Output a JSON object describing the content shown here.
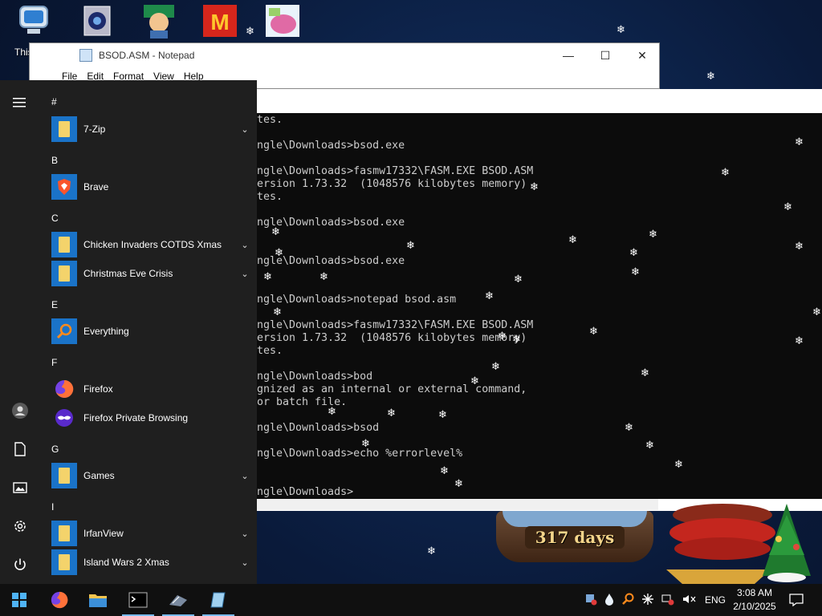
{
  "desktop": {
    "icons": [
      {
        "name": "this-pc-icon"
      },
      {
        "name": "cube-app-icon"
      },
      {
        "name": "game-character-icon"
      },
      {
        "name": "mcdonalds-game-icon"
      },
      {
        "name": "pig-game-icon"
      }
    ],
    "this_pc_label": "This PC"
  },
  "notepad": {
    "title": "BSOD.ASM - Notepad",
    "menu": [
      "File",
      "Edit",
      "Format",
      "View",
      "Help"
    ]
  },
  "console": {
    "lines": [
      "tes.",
      "",
      "ngle\\Downloads>bsod.exe",
      "",
      "ngle\\Downloads>fasmw17332\\FASM.EXE BSOD.ASM",
      "ersion 1.73.32  (1048576 kilobytes memory)",
      "tes.",
      "",
      "ngle\\Downloads>bsod.exe",
      "",
      "",
      "ngle\\Downloads>bsod.exe",
      "",
      "",
      "ngle\\Downloads>notepad bsod.asm",
      "",
      "ngle\\Downloads>fasmw17332\\FASM.EXE BSOD.ASM",
      "ersion 1.73.32  (1048576 kilobytes memory)",
      "tes.",
      "",
      "ngle\\Downloads>bod",
      "gnized as an internal or external command,",
      "or batch file.",
      "",
      "ngle\\Downloads>bsod",
      "",
      "ngle\\Downloads>echo %errorlevel%",
      "",
      "",
      "ngle\\Downloads>"
    ]
  },
  "countdown": {
    "label": "317 days"
  },
  "start_menu": {
    "groups": [
      {
        "letter": "#",
        "apps": [
          {
            "name": "7-Zip",
            "icon": "folder-icon",
            "expandable": true
          }
        ]
      },
      {
        "letter": "B",
        "apps": [
          {
            "name": "Brave",
            "icon": "brave-icon",
            "expandable": false
          }
        ]
      },
      {
        "letter": "C",
        "apps": [
          {
            "name": "Chicken Invaders COTDS Xmas",
            "icon": "folder-icon",
            "expandable": true
          },
          {
            "name": "Christmas Eve Crisis",
            "icon": "folder-icon",
            "expandable": true
          }
        ]
      },
      {
        "letter": "E",
        "apps": [
          {
            "name": "Everything",
            "icon": "magnifier-icon",
            "expandable": false
          }
        ]
      },
      {
        "letter": "F",
        "apps": [
          {
            "name": "Firefox",
            "icon": "firefox-icon",
            "expandable": false
          },
          {
            "name": "Firefox Private Browsing",
            "icon": "firefox-private-icon",
            "expandable": false
          }
        ]
      },
      {
        "letter": "G",
        "apps": [
          {
            "name": "Games",
            "icon": "folder-icon",
            "expandable": true
          }
        ]
      },
      {
        "letter": "I",
        "apps": [
          {
            "name": "IrfanView",
            "icon": "folder-icon",
            "expandable": true
          },
          {
            "name": "Island Wars 2 Xmas",
            "icon": "folder-icon",
            "expandable": true
          }
        ]
      }
    ],
    "rail": [
      "hamburger-icon",
      "user-icon",
      "document-icon",
      "pictures-icon",
      "settings-icon",
      "power-icon"
    ]
  },
  "taskbar": {
    "pinned": [
      "start-button",
      "firefox-icon",
      "file-explorer-icon",
      "command-prompt-icon",
      "snow-app-icon",
      "notepad-icon"
    ],
    "tray": {
      "language": "ENG",
      "time": "3:08 AM",
      "date": "2/10/2025"
    }
  }
}
